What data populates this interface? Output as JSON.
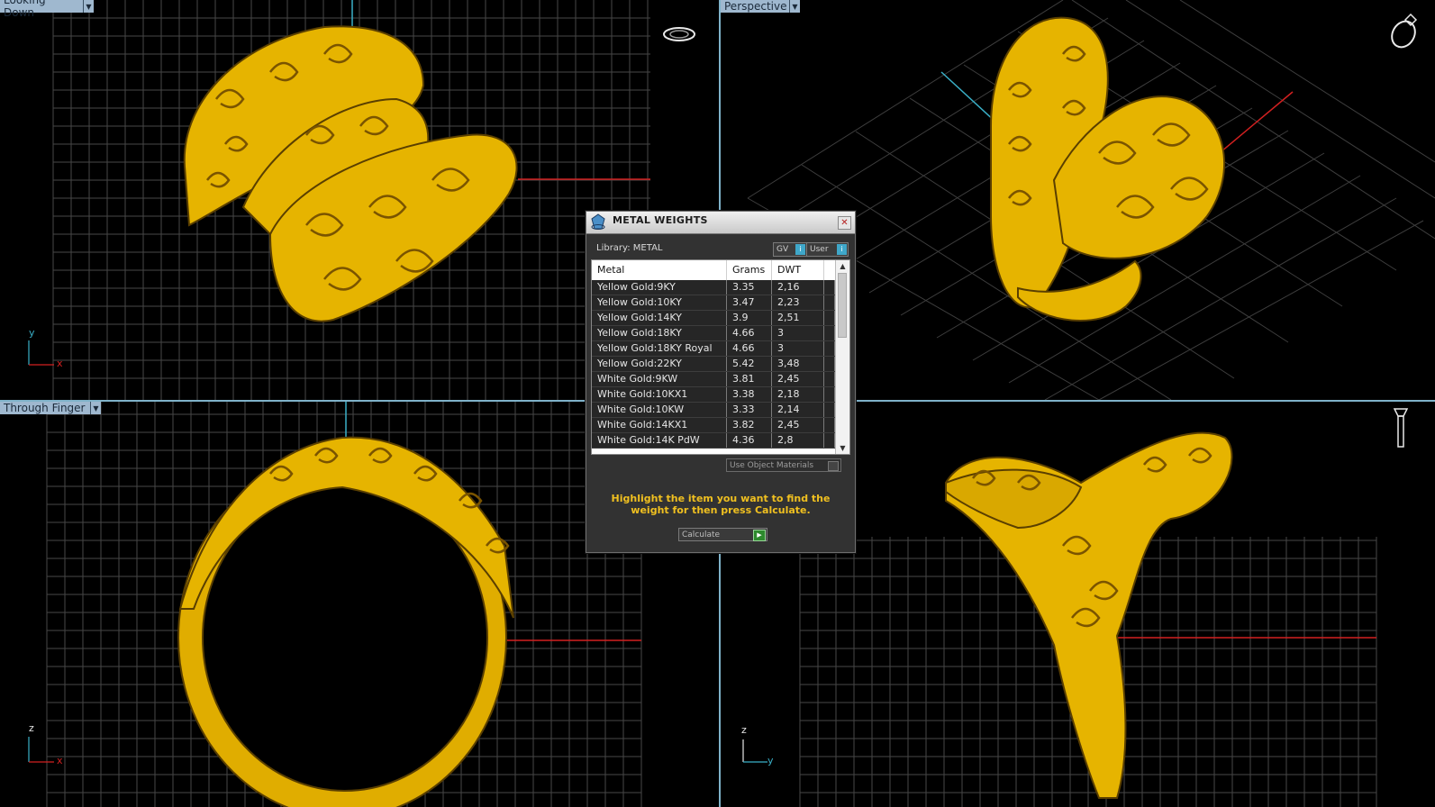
{
  "viewports": {
    "top_left": {
      "label": "Looking Down",
      "axis_v": "y",
      "axis_h": "x"
    },
    "top_right": {
      "label": "Perspective"
    },
    "bottom_left": {
      "label": "Through Finger",
      "axis_v": "z",
      "axis_h": "x"
    },
    "bottom_right": {
      "axis_v": "z",
      "axis_h": "y"
    }
  },
  "dialog": {
    "title": "METAL WEIGHTS",
    "library_label": "Library: METAL",
    "gv_label": "GV",
    "user_label": "User",
    "columns": [
      "Metal",
      "Grams",
      "DWT"
    ],
    "rows": [
      [
        "Yellow Gold:9KY",
        "3.35",
        "2,16"
      ],
      [
        "Yellow Gold:10KY",
        "3.47",
        "2,23"
      ],
      [
        "Yellow Gold:14KY",
        "3.9",
        "2,51"
      ],
      [
        "Yellow Gold:18KY",
        "4.66",
        "3"
      ],
      [
        "Yellow Gold:18KY Royal",
        "4.66",
        "3"
      ],
      [
        "Yellow Gold:22KY",
        "5.42",
        "3,48"
      ],
      [
        "White Gold:9KW",
        "3.81",
        "2,45"
      ],
      [
        "White Gold:10KX1",
        "3.38",
        "2,18"
      ],
      [
        "White Gold:10KW",
        "3.33",
        "2,14"
      ],
      [
        "White Gold:14KX1",
        "3.82",
        "2,45"
      ],
      [
        "White Gold:14K PdW",
        "4.36",
        "2,8"
      ]
    ],
    "use_object_materials": "Use Object Materials",
    "hint": "Highlight the item you want to find the weight for then press Calculate.",
    "calculate_label": "Calculate"
  },
  "colors": {
    "gold": "#f2c200",
    "grid": "#4a4a4a",
    "axis_red": "#d22020",
    "axis_cyan": "#3ab0c8",
    "divider": "#7fb2c9",
    "hint": "#f0c020"
  },
  "icons": [
    "ring-navigator-icon",
    "metal-weights-logo-icon",
    "close-icon",
    "play-icon"
  ]
}
